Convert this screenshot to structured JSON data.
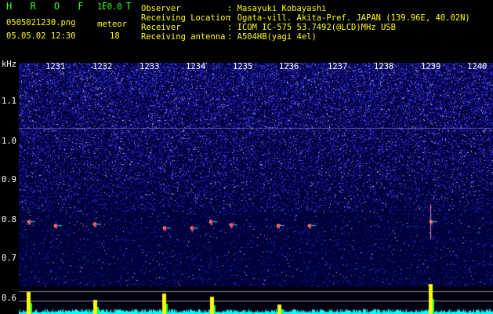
{
  "app": {
    "name": "H R O F F T",
    "version": "1.0.0",
    "filename": "0505021230.png",
    "datetime": "05.05.02 12:30",
    "meteor_label": "meteor",
    "meteor_count": "18"
  },
  "station": {
    "rows": [
      {
        "label": "Observer",
        "value": ": Masayuki Kobayashi"
      },
      {
        "label": "Receiving Location",
        "value": ": Ogata-vill. Akita-Pref. JAPAN (139.96E, 40.02N)"
      },
      {
        "label": "Receiver",
        "value": ": ICOM IC-575 53.7492(@LCD)MHz USB"
      },
      {
        "label": "Receiving antenna",
        "value": ": A504HB(yagi 4el)"
      }
    ]
  },
  "axis": {
    "unit": "kHz",
    "time_ticks": [
      "1231",
      "1232",
      "1233",
      "1234",
      "1235",
      "1236",
      "1237",
      "1238",
      "1239",
      "1240"
    ],
    "freq_ticks": [
      "1.1",
      "1.0",
      "0.9",
      "0.8",
      "0.7",
      "0.6"
    ]
  },
  "colors": {
    "header_green": "#33ff33",
    "header_yellow": "#ffff00",
    "background": "#00003a",
    "noise": "#2a2aff",
    "signal": "#ff4080",
    "level": "#00ffff",
    "peak": "#ffff00"
  }
}
